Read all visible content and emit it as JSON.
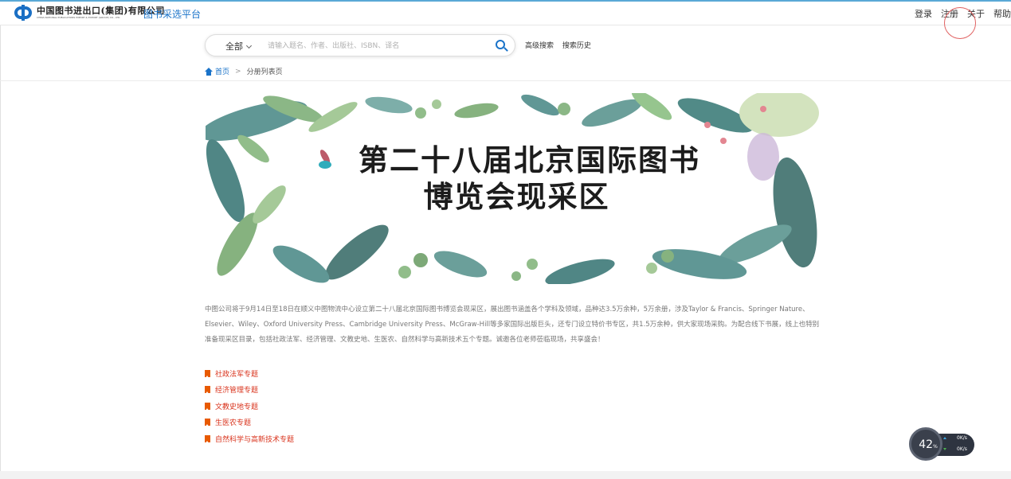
{
  "header": {
    "logo_cn": "中国图书进出口(集团)有限公司",
    "logo_en": "CHINA NATIONAL PUBLICATIONS IMPORT & EXPORT (GROUP) CO., LTD.",
    "platform_name": "图书采选平台",
    "nav": {
      "login": "登录",
      "register": "注册",
      "about": "关于",
      "help": "帮助"
    },
    "accent_color": "#1a73c9"
  },
  "search": {
    "category": "全部",
    "placeholder": "请输入题名、作者、出版社、ISBN、译名",
    "value": "",
    "advanced_search": "高级搜索",
    "search_history": "搜索历史"
  },
  "breadcrumb": {
    "home": "首页",
    "current": "分册列表页"
  },
  "banner": {
    "title_line1": "第二十八届北京国际图书",
    "title_line2": "博览会现采区"
  },
  "description": "中图公司将于9月14日至18日在顺义中图物流中心设立第二十八届北京国际图书博览会现采区，展出图书涵盖各个学科及领域，品种达3.5万余种，5万余册，涉及Taylor & Francis、Springer Nature、Elsevier、Wiley、Oxford University Press、Cambridge University Press、McGraw-Hill等多家国际出版巨头，还专门设立特价书专区，共1.5万余种，供大家现场采购。为配合线下书展，线上也特别准备现采区目录，包括社政法军、经济管理、文教史地、生医农、自然科学与高新技术五个专题。诚邀各位老师莅临现场，共享盛会！",
  "topics": [
    {
      "label": "社政法军专题"
    },
    {
      "label": "经济管理专题"
    },
    {
      "label": "文教史地专题"
    },
    {
      "label": "生医农专题"
    },
    {
      "label": "自然科学与高新技术专题"
    }
  ],
  "net_monitor": {
    "percent": "42",
    "percent_unit": "%",
    "upload": "0K/s",
    "download": "0K/s"
  }
}
